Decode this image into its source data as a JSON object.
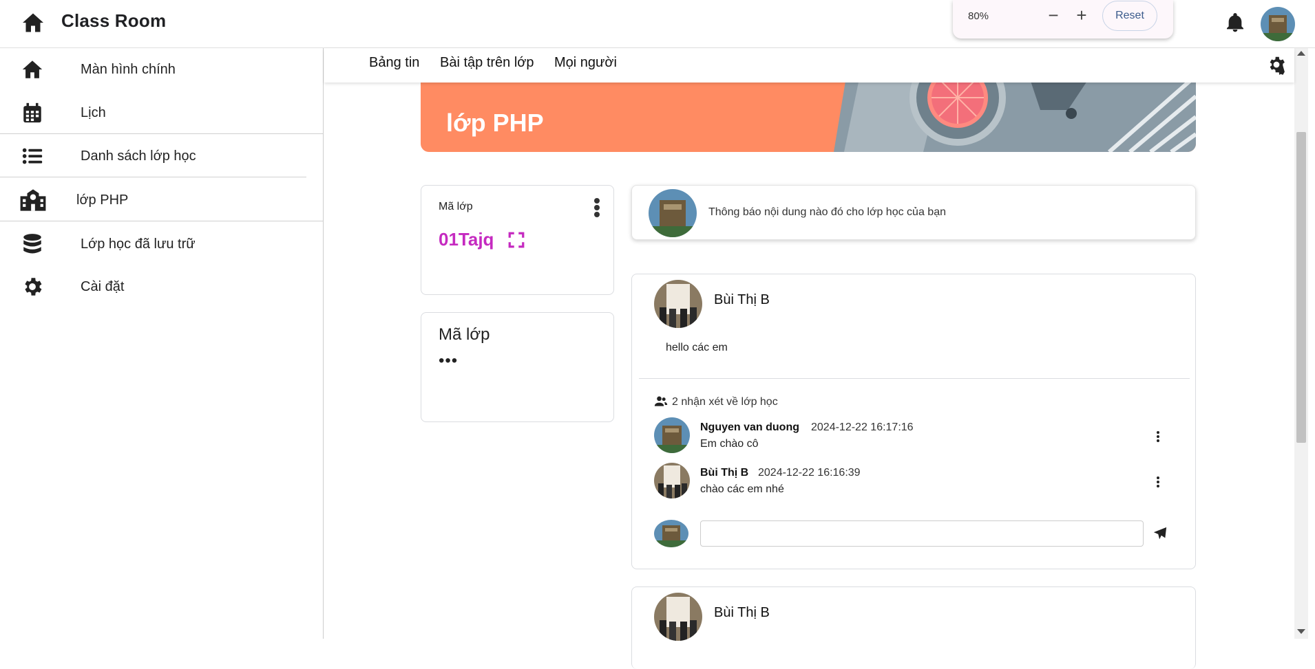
{
  "app": {
    "title": "Class Room"
  },
  "zoom": {
    "level": "80%",
    "minus_label": "−",
    "plus_label": "+",
    "reset_label": "Reset"
  },
  "misc": {
    "stray_mark": ";"
  },
  "sidebar": {
    "items": [
      {
        "label": "Màn hình chính",
        "icon": "home-icon"
      },
      {
        "label": "Lịch",
        "icon": "calendar-icon"
      },
      {
        "label": "Danh sách lớp học",
        "icon": "list-icon"
      },
      {
        "label": "lớp PHP",
        "icon": "school-icon"
      },
      {
        "label": "Lớp học đã lưu trữ",
        "icon": "database-icon"
      },
      {
        "label": "Cài đặt",
        "icon": "gear-icon"
      }
    ]
  },
  "subnav": {
    "tabs": [
      "Bảng tin",
      "Bài tập trên lớp",
      "Mọi người"
    ]
  },
  "banner": {
    "title": "lớp PHP",
    "color": "#ff8b62"
  },
  "class_code_card": {
    "label": "Mã lớp",
    "code": "01Tajq",
    "code_color": "#c52ac0"
  },
  "upcoming_card": {
    "title": "Mã lớp",
    "dots": "•••"
  },
  "announce": {
    "placeholder": "Thông báo nội dung nào đó cho lớp học của bạn"
  },
  "posts": [
    {
      "author": "Bùi Thị B",
      "body": "hello các em",
      "comment_count_text": "2 nhận xét về lớp học",
      "comments": [
        {
          "name": "Nguyen van duong",
          "time": "2024-12-22 16:17:16",
          "text": "Em chào cô"
        },
        {
          "name": "Bùi Thị B",
          "time": "2024-12-22 16:16:39",
          "text": "chào các em nhé"
        }
      ],
      "reply_value": ""
    },
    {
      "author": "Bùi Thị B"
    }
  ]
}
